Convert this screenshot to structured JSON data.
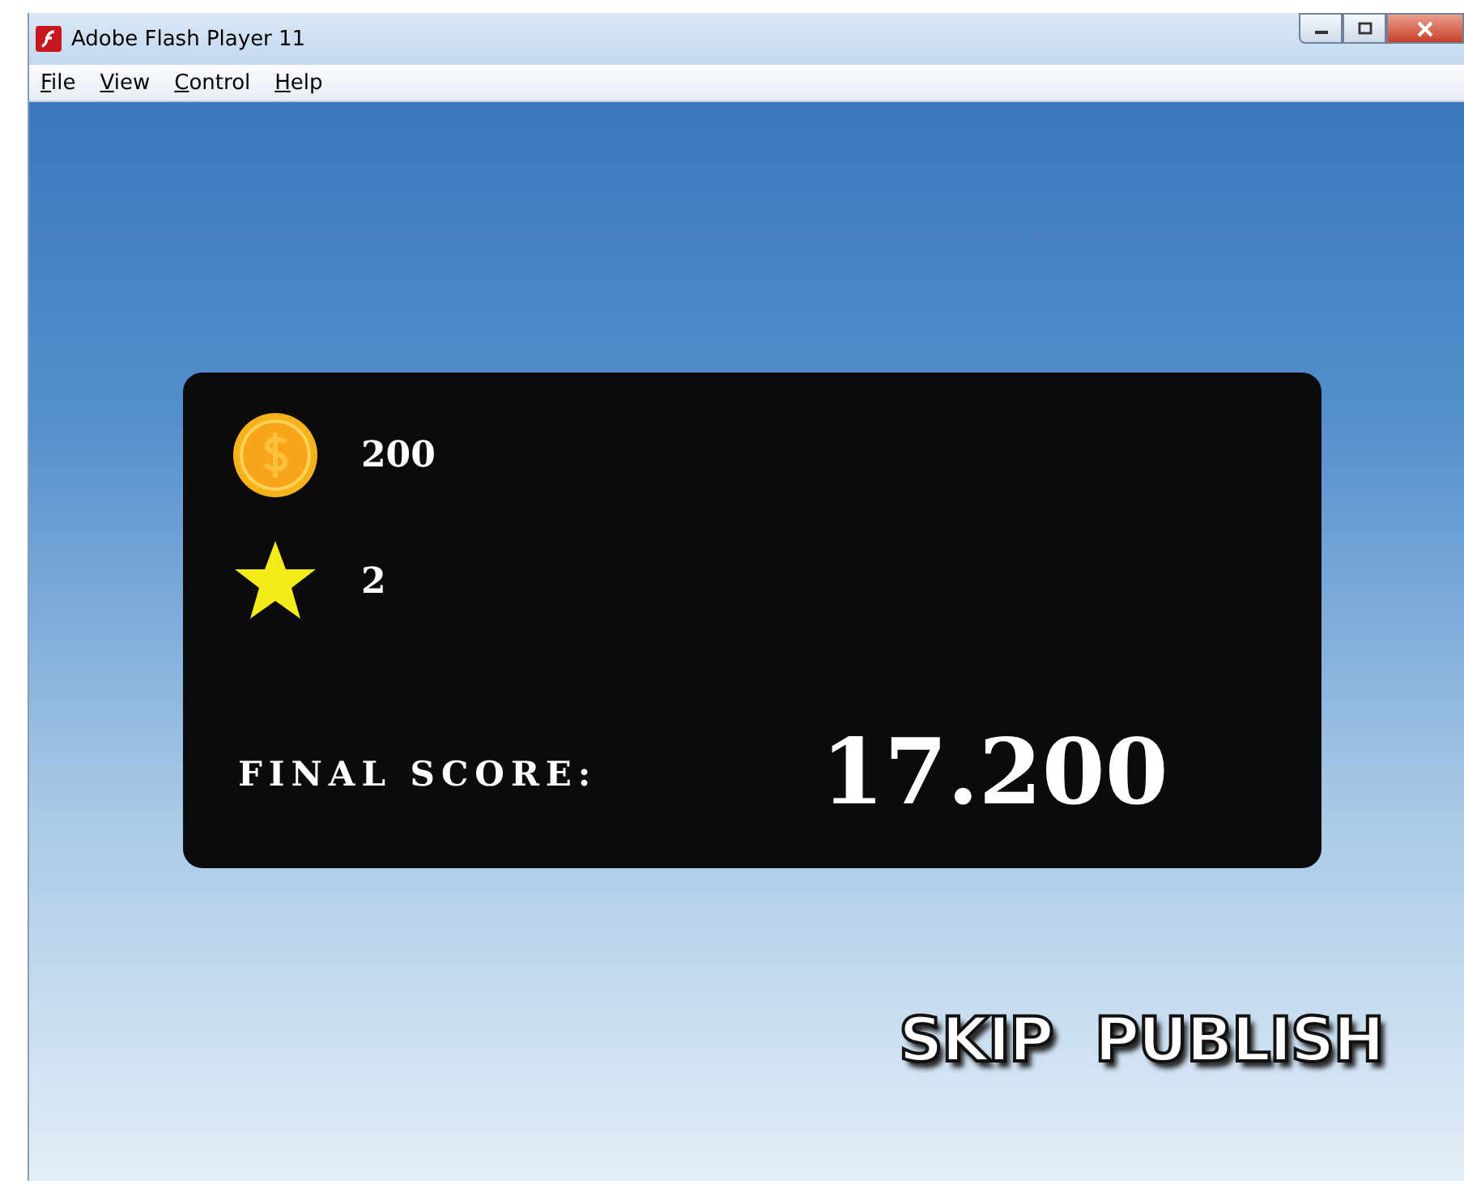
{
  "window": {
    "title": "Adobe Flash Player 11"
  },
  "menu": [
    {
      "label": "File"
    },
    {
      "label": "View"
    },
    {
      "label": "Control"
    },
    {
      "label": "Help"
    }
  ],
  "results": {
    "coins": "200",
    "stars_count": "2",
    "final_score_label": "FINAL SCORE:",
    "final_score": "17.200"
  },
  "buttons": [
    {
      "label": "SKIP"
    },
    {
      "label": "PUBLISH"
    }
  ]
}
